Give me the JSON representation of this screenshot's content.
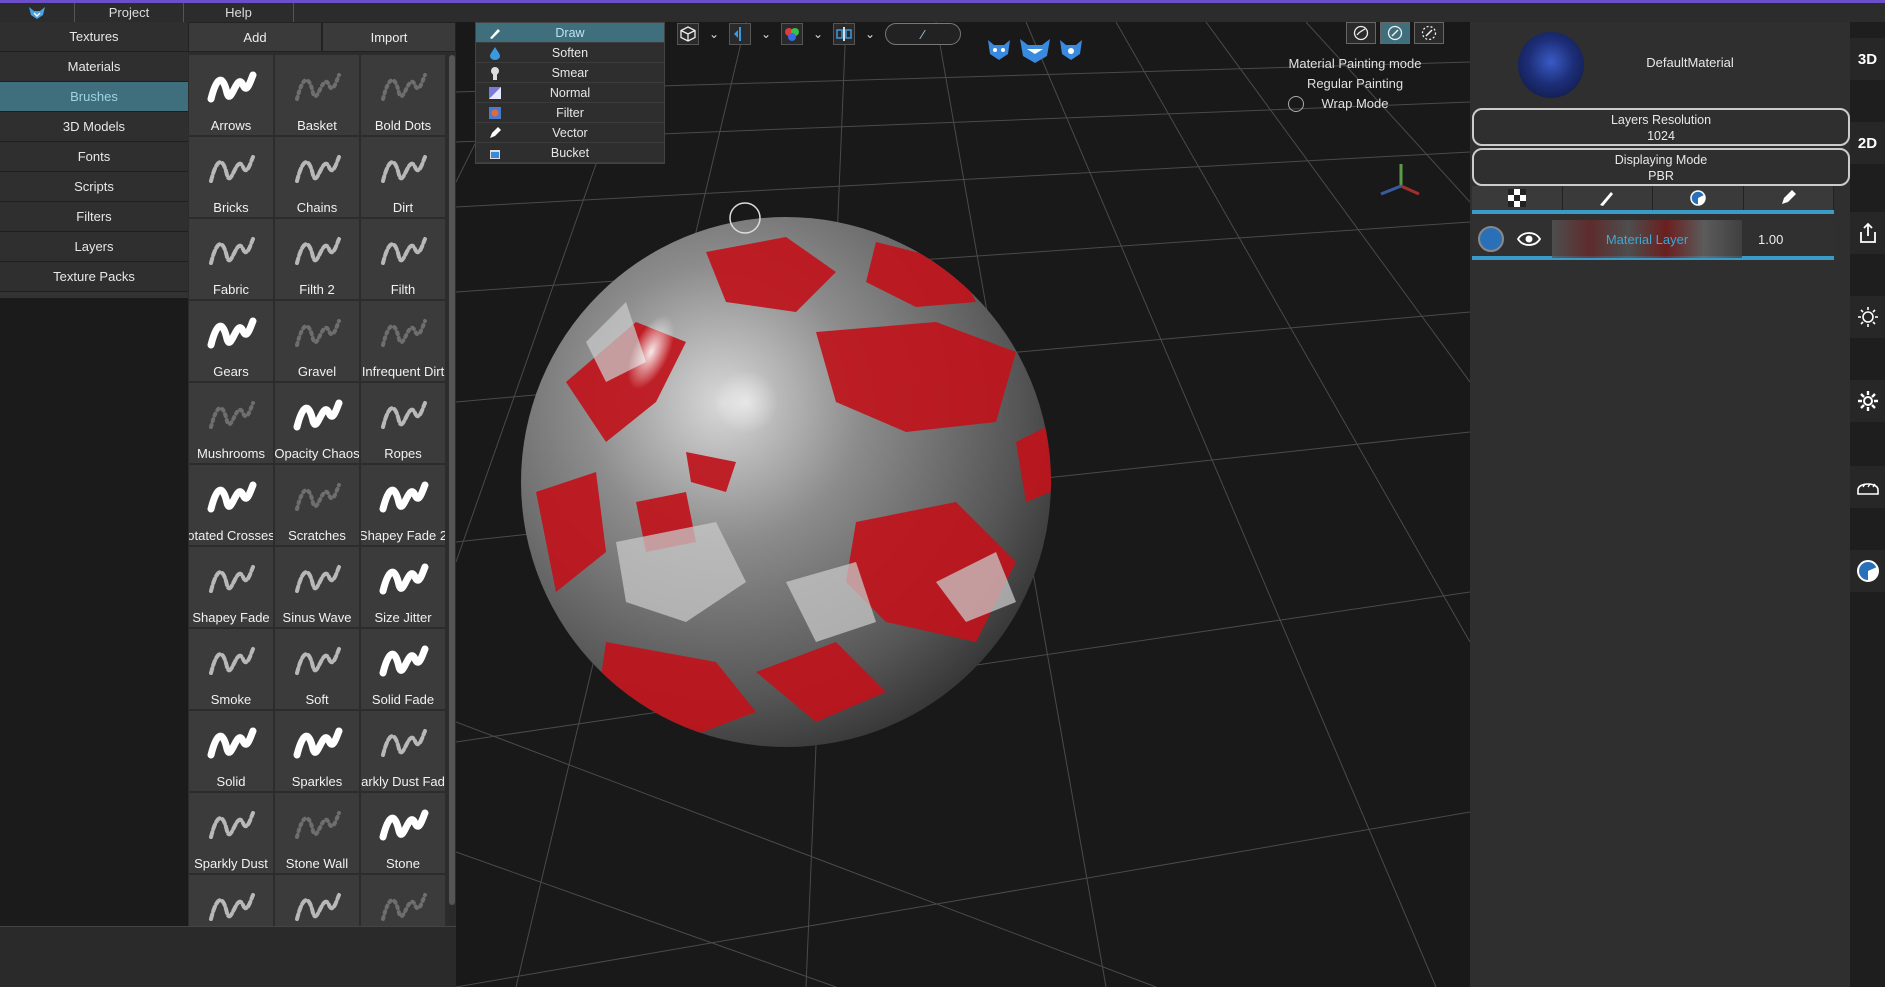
{
  "menu": {
    "items": [
      {
        "label": "Project"
      },
      {
        "label": "Help"
      }
    ],
    "logo_icon": "fox-logo-icon"
  },
  "left_nav": {
    "items": [
      {
        "label": "Textures",
        "active": false
      },
      {
        "label": "Materials",
        "active": false
      },
      {
        "label": "Brushes",
        "active": true
      },
      {
        "label": "3D Models",
        "active": false
      },
      {
        "label": "Fonts",
        "active": false
      },
      {
        "label": "Scripts",
        "active": false
      },
      {
        "label": "Filters",
        "active": false
      },
      {
        "label": "Layers",
        "active": false
      },
      {
        "label": "Texture Packs",
        "active": false
      }
    ]
  },
  "brush_panel": {
    "add_label": "Add",
    "import_label": "Import",
    "brushes": [
      {
        "label": "Arrows",
        "style": "bright"
      },
      {
        "label": "Basket",
        "style": "dim"
      },
      {
        "label": "Bold Dots",
        "style": "dim"
      },
      {
        "label": "Bricks",
        "style": "mid"
      },
      {
        "label": "Chains",
        "style": "mid"
      },
      {
        "label": "Dirt",
        "style": "mid"
      },
      {
        "label": "Fabric",
        "style": "mid"
      },
      {
        "label": "Filth 2",
        "style": "mid"
      },
      {
        "label": "Filth",
        "style": "mid"
      },
      {
        "label": "Gears",
        "style": "bright"
      },
      {
        "label": "Gravel",
        "style": "dim"
      },
      {
        "label": "Infrequent Dirt",
        "style": "dim"
      },
      {
        "label": "Mushrooms",
        "style": "dim"
      },
      {
        "label": "Opacity Chaos",
        "style": "bright"
      },
      {
        "label": "Ropes",
        "style": "mid"
      },
      {
        "label": "otated Crosses",
        "style": "bright"
      },
      {
        "label": "Scratches",
        "style": "dim"
      },
      {
        "label": "Shapey Fade 2",
        "style": "bright"
      },
      {
        "label": "Shapey Fade",
        "style": "mid"
      },
      {
        "label": "Sinus Wave",
        "style": "mid"
      },
      {
        "label": "Size Jitter",
        "style": "bright"
      },
      {
        "label": "Smoke",
        "style": "mid"
      },
      {
        "label": "Soft",
        "style": "mid"
      },
      {
        "label": "Solid Fade",
        "style": "bright"
      },
      {
        "label": "Solid",
        "style": "bright"
      },
      {
        "label": "Sparkles",
        "style": "bright"
      },
      {
        "label": "parkly Dust Fade",
        "style": "mid"
      },
      {
        "label": "Sparkly Dust",
        "style": "mid"
      },
      {
        "label": "Stone Wall",
        "style": "dim"
      },
      {
        "label": "Stone",
        "style": "bright"
      },
      {
        "label": "",
        "style": "mid"
      },
      {
        "label": "",
        "style": "mid"
      },
      {
        "label": "",
        "style": "dim"
      }
    ]
  },
  "tools": {
    "items": [
      {
        "label": "Draw",
        "icon": "brush-icon",
        "active": true
      },
      {
        "label": "Soften",
        "icon": "drop-icon",
        "active": false
      },
      {
        "label": "Smear",
        "icon": "finger-icon",
        "active": false
      },
      {
        "label": "Normal",
        "icon": "normal-map-icon",
        "active": false
      },
      {
        "label": "Filter",
        "icon": "filter-icon",
        "active": false
      },
      {
        "label": "Vector",
        "icon": "pen-icon",
        "active": false
      },
      {
        "label": "Bucket",
        "icon": "bucket-icon",
        "active": false
      }
    ]
  },
  "viewport": {
    "brush_size_label": "∕",
    "mode_lines": {
      "material_painting": "Material Painting mode",
      "regular_painting": "Regular Painting",
      "wrap_mode": "Wrap Mode"
    },
    "colors": {
      "paint_red": "#c0141c",
      "sphere_grey": "#8a8a8a",
      "accent": "#3f6f7c"
    }
  },
  "right_panel": {
    "material_name": "DefaultMaterial",
    "layers_resolution_label": "Layers Resolution",
    "layers_resolution_value": "1024",
    "displaying_mode_label": "Displaying Mode",
    "displaying_mode_value": "PBR",
    "layer": {
      "name": "Material Layer",
      "opacity": "1.00"
    }
  },
  "side_rail": {
    "mode_3d": "3D",
    "mode_2d": "2D"
  }
}
